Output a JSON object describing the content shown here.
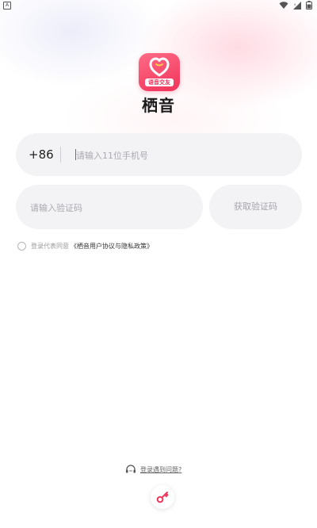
{
  "status_bar": {
    "left_icon": "notification-a-icon",
    "left_glyph": "A",
    "right_icons": [
      "wifi-icon",
      "signal-icon",
      "battery-icon"
    ]
  },
  "app": {
    "name": "栖音",
    "logo_tag": "语音交友",
    "brand_color": "#F0345A"
  },
  "login": {
    "country_code": "+86",
    "phone_placeholder": "请输入11位手机号",
    "code_placeholder": "请输入验证码",
    "get_code_label": "获取验证码",
    "agreement_prefix": "登录代表同意",
    "agreement_link": "《栖音用户协议与隐私政策》",
    "agreed": false
  },
  "footer": {
    "help_label": "登录遇到问题?",
    "help_icon": "headset-icon",
    "key_icon": "key-icon"
  }
}
